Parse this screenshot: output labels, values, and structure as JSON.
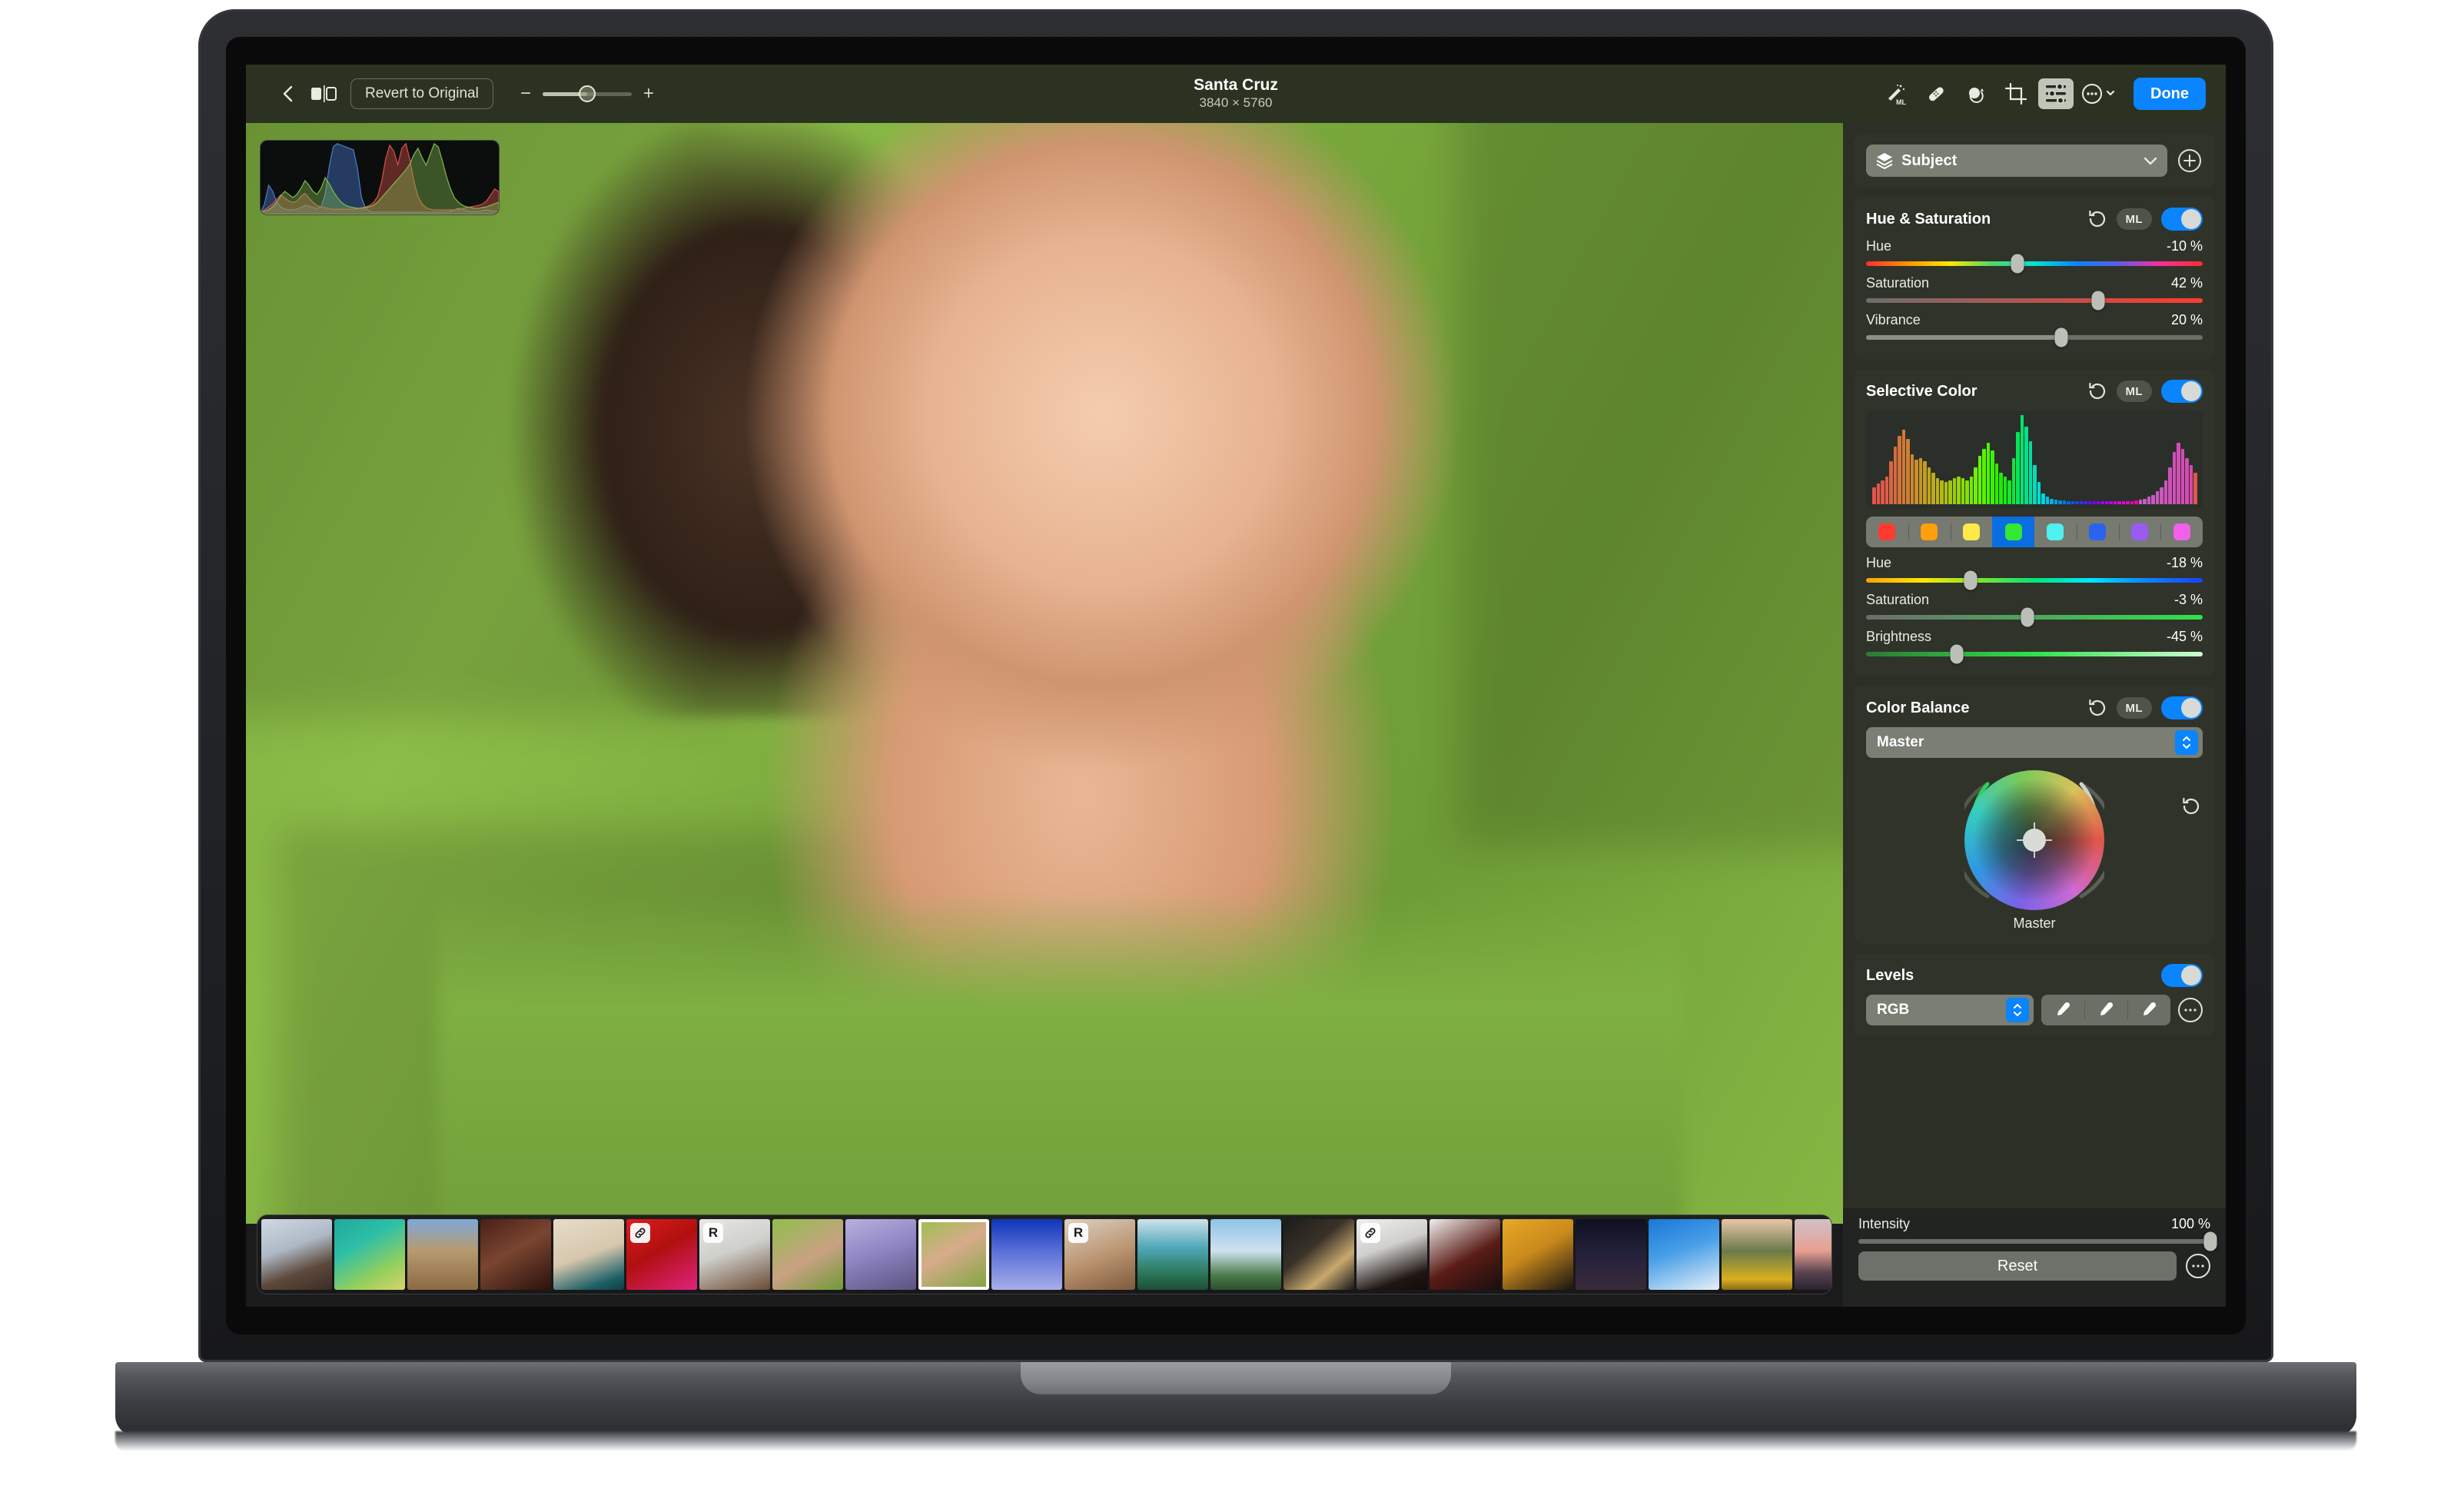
{
  "device": {
    "name": "macbook-pro",
    "camera": "camera-dot"
  },
  "toolbar": {
    "back_icon": "chevron-left-icon",
    "compare_icon": "before-after-split-icon",
    "revert_label": "Revert to Original",
    "zoom_minus": "−",
    "zoom_plus": "+",
    "zoom_value_pct": 50,
    "title": "Santa Cruz",
    "dimensions": "3840 × 5760",
    "tools": [
      {
        "name": "auto-enhance-ml-icon",
        "label": "ML",
        "active": false
      },
      {
        "name": "retouch-icon",
        "label": "",
        "active": false
      },
      {
        "name": "red-eye-icon",
        "label": "",
        "active": false
      },
      {
        "name": "crop-icon",
        "label": "",
        "active": false
      },
      {
        "name": "adjust-icon",
        "label": "",
        "active": true
      },
      {
        "name": "more-options-icon",
        "label": "",
        "active": false
      }
    ],
    "done_label": "Done"
  },
  "histogram_overlay": {
    "name": "rgb-histogram",
    "channels": [
      {
        "name": "blue",
        "color": "#4a7fd4",
        "points": [
          2,
          14,
          38,
          30,
          16,
          10,
          7,
          6,
          6,
          7,
          9,
          12,
          11,
          9,
          8,
          10,
          26,
          62,
          88,
          92,
          90,
          88,
          86,
          84,
          60,
          22,
          8,
          4,
          3,
          3,
          3,
          3,
          3,
          3,
          3,
          3,
          3,
          3,
          3,
          3,
          3,
          3,
          3,
          3,
          3,
          3,
          3,
          4,
          6,
          8,
          7,
          5,
          4,
          4,
          4,
          5,
          6,
          5,
          4,
          4
        ]
      },
      {
        "name": "red",
        "color": "#d9524a",
        "points": [
          3,
          6,
          10,
          14,
          20,
          26,
          22,
          18,
          16,
          18,
          24,
          28,
          22,
          16,
          12,
          10,
          9,
          8,
          7,
          7,
          7,
          7,
          7,
          7,
          8,
          9,
          10,
          12,
          16,
          24,
          44,
          74,
          92,
          84,
          66,
          88,
          94,
          72,
          44,
          24,
          14,
          9,
          7,
          6,
          6,
          6,
          6,
          6,
          6,
          7,
          8,
          9,
          10,
          11,
          12,
          14,
          18,
          26,
          34,
          30
        ]
      },
      {
        "name": "green",
        "color": "#7fbb4e",
        "points": [
          2,
          4,
          6,
          10,
          16,
          24,
          30,
          26,
          22,
          26,
          34,
          44,
          38,
          30,
          26,
          34,
          48,
          40,
          30,
          22,
          16,
          12,
          10,
          9,
          8,
          8,
          9,
          10,
          12,
          16,
          22,
          28,
          34,
          40,
          46,
          52,
          58,
          66,
          78,
          86,
          74,
          64,
          78,
          92,
          88,
          70,
          50,
          34,
          22,
          16,
          12,
          10,
          9,
          8,
          8,
          9,
          10,
          12,
          14,
          16
        ]
      }
    ]
  },
  "filmstrip": {
    "name": "photo-filmstrip",
    "selected_index": 9,
    "thumbnails": [
      {
        "name": "portrait-woman-profile",
        "badge": "",
        "css": "linear-gradient(160deg,#cfd9e2 0%,#aeb9c6 40%,#5d4a3c 70%,#3b2c22 100%)"
      },
      {
        "name": "underwater-coral",
        "badge": "",
        "css": "linear-gradient(150deg,#1fa89a 0%,#2dbfa8 35%,#8fcf5e 70%,#d9d36a 100%)"
      },
      {
        "name": "desert-arch",
        "badge": "",
        "css": "linear-gradient(180deg,#7fa8d8 0%,#b79a6e 45%,#8b6a44 100%)"
      },
      {
        "name": "portrait-dark-skin",
        "badge": "",
        "css": "linear-gradient(150deg,#4a2018 0%,#7a4530 45%,#2a120c 100%)"
      },
      {
        "name": "portrait-shadow-beige",
        "badge": "",
        "css": "linear-gradient(160deg,#e8ddc9 0%,#d6c7ad 50%,#1d5f66 85%,#123c44 100%)"
      },
      {
        "name": "portrait-red-background",
        "badge": "link-icon",
        "css": "linear-gradient(150deg,#e01b1b 0%,#b01010 45%,#e0227c 100%)"
      },
      {
        "name": "portrait-white-suit",
        "badge": "R",
        "css": "linear-gradient(160deg,#e7e7e5 0%,#cfcfcb 45%,#6a4a32 100%)"
      },
      {
        "name": "portrait-green-hood",
        "badge": "",
        "css": "linear-gradient(150deg,#8fbf4a 0%,#c9a184 55%,#6f9a36 100%)"
      },
      {
        "name": "portrait-lavender",
        "badge": "",
        "css": "linear-gradient(160deg,#b9b0de 0%,#8f86c4 45%,#5c5280 100%)"
      },
      {
        "name": "portrait-santa-cruz-selected",
        "badge": "",
        "css": "linear-gradient(150deg,#9bc04f 0%,#d7ab8b 45%,#7aa63c 100%)"
      },
      {
        "name": "blue-rocks",
        "badge": "",
        "css": "linear-gradient(180deg,#1034b8 0%,#5a6fd8 45%,#a8aee8 100%)"
      },
      {
        "name": "portrait-braids-beige",
        "badge": "R",
        "css": "linear-gradient(160deg,#ddd2c2 0%,#b9926e 55%,#7d5a3c 100%)"
      },
      {
        "name": "aerial-beach",
        "badge": "",
        "css": "linear-gradient(180deg,#cfe2ea 0%,#4fa8b8 40%,#2e7a5c 75%,#1c4e38 100%)"
      },
      {
        "name": "clouds-mountain",
        "badge": "",
        "css": "linear-gradient(180deg,#8fc3e8 0%,#cfe2f0 45%,#4a7a4a 80%,#2c4e2e 100%)"
      },
      {
        "name": "modern-building",
        "badge": "",
        "css": "linear-gradient(140deg,#1b1b1d 0%,#3a3228 40%,#c8a86e 70%,#17171a 100%)"
      },
      {
        "name": "silhouette-portrait-white",
        "badge": "link-icon",
        "css": "linear-gradient(160deg,#efefee 0%,#cfcfcd 40%,#201613 80%,#120c0a 100%)"
      },
      {
        "name": "silhouette-portrait-dark",
        "badge": "",
        "css": "linear-gradient(150deg,#efefee 0%,#5b1c16 55%,#170e0c 100%)"
      },
      {
        "name": "silhouette-orange",
        "badge": "",
        "css": "linear-gradient(150deg,#e8a828 0%,#c98a1c 45%,#1a1410 100%)"
      },
      {
        "name": "night-flowers",
        "badge": "",
        "css": "linear-gradient(180deg,#0d1020 0%,#23203a 45%,#3a2a3a 100%)"
      },
      {
        "name": "snowboarder",
        "badge": "",
        "css": "linear-gradient(160deg,#1878d8 0%,#4aa0e8 45%,#e8f0f8 100%)"
      },
      {
        "name": "golden-mountain",
        "badge": "",
        "css": "linear-gradient(180deg,#e8c6a8 0%,#6a7a4a 45%,#d8b020 85%,#8a6a18 100%)"
      },
      {
        "name": "pink-sunset-peak",
        "badge": "",
        "css": "linear-gradient(180deg,#cfc0c8 0%,#e8a090 45%,#5a4450 75%,#2a2230 100%)"
      },
      {
        "name": "architecture-white-stairs",
        "badge": "link-icon",
        "css": "linear-gradient(150deg,#e6e6e6 0%,#c4c4c4 50%,#9a9a9a 100%)"
      },
      {
        "name": "blue-building-facade",
        "badge": "",
        "css": "linear-gradient(160deg,#10447a 0%,#1a5a9a 50%,#0c2c52 100%)"
      }
    ]
  },
  "inspector": {
    "selection": {
      "name": "subject-selection",
      "icon": "layers-icon",
      "label": "Subject",
      "chevron_icon": "chevron-down-icon",
      "add_icon": "add-circle-icon"
    },
    "hue_saturation": {
      "title": "Hue & Saturation",
      "revert_icon": "revert-arrow-icon",
      "ml_label": "ML",
      "enabled": true,
      "sliders": [
        {
          "name": "hue",
          "label": "Hue",
          "value": "-10 %",
          "pos_pct": 45,
          "kind": "hue-full"
        },
        {
          "name": "saturation",
          "label": "Saturation",
          "value": "42 %",
          "pos_pct": 69,
          "kind": "sat-red"
        },
        {
          "name": "vibrance",
          "label": "Vibrance",
          "value": "20 %",
          "pos_pct": 58,
          "kind": "plain"
        }
      ]
    },
    "selective_color": {
      "title": "Selective Color",
      "revert_icon": "revert-arrow-icon",
      "ml_label": "ML",
      "enabled": true,
      "selected_swatch_index": 3,
      "swatches": [
        {
          "name": "swatch-red",
          "color": "#ff3b30"
        },
        {
          "name": "swatch-orange",
          "color": "#ff9f0a"
        },
        {
          "name": "swatch-yellow",
          "color": "#ffe94a"
        },
        {
          "name": "swatch-green",
          "color": "#34e834"
        },
        {
          "name": "swatch-cyan",
          "color": "#4ff0f0"
        },
        {
          "name": "swatch-blue",
          "color": "#2b62f0"
        },
        {
          "name": "swatch-purple",
          "color": "#9a5cf0"
        },
        {
          "name": "swatch-magenta",
          "color": "#f060e8"
        }
      ],
      "sliders": [
        {
          "name": "hue",
          "label": "Hue",
          "value": "-18 %",
          "pos_pct": 31,
          "kind": "hue-sel"
        },
        {
          "name": "saturation",
          "label": "Saturation",
          "value": "-3 %",
          "pos_pct": 48,
          "kind": "sat-green"
        },
        {
          "name": "brightness",
          "label": "Brightness",
          "value": "-45 %",
          "pos_pct": 27,
          "kind": "bri-green"
        }
      ]
    },
    "hue_histogram": {
      "name": "hue-histogram",
      "values": [
        18,
        22,
        26,
        30,
        46,
        62,
        74,
        80,
        70,
        54,
        48,
        50,
        46,
        40,
        34,
        28,
        26,
        24,
        26,
        28,
        30,
        28,
        26,
        30,
        40,
        52,
        60,
        66,
        58,
        44,
        34,
        30,
        26,
        50,
        78,
        96,
        84,
        68,
        42,
        24,
        12,
        8,
        6,
        5,
        4,
        4,
        3,
        3,
        3,
        3,
        3,
        3,
        3,
        3,
        3,
        3,
        3,
        3,
        3,
        3,
        3,
        3,
        4,
        5,
        6,
        8,
        10,
        14,
        18,
        26,
        40,
        56,
        66,
        60,
        50,
        42,
        34
      ],
      "colors": [
        "#e2564a",
        "#e2564a",
        "#e2564a",
        "#de5d46",
        "#db6442",
        "#d86b3e",
        "#d5723a",
        "#d27936",
        "#cf8032",
        "#cc872e",
        "#c98e2a",
        "#c69526",
        "#c39c22",
        "#c0a31e",
        "#bdaa1a",
        "#baB116",
        "#b7b812",
        "#aebf10",
        "#a5c60e",
        "#9ccd0c",
        "#93d40a",
        "#8adb08",
        "#81e206",
        "#78e904",
        "#6ff002",
        "#66f700",
        "#58f500",
        "#4af300",
        "#3cf100",
        "#2eef00",
        "#20ed00",
        "#18eb10",
        "#12e928",
        "#0ce740",
        "#06e558",
        "#00e370",
        "#00e188",
        "#00dfa0",
        "#00ddb8",
        "#00dbd0",
        "#00d4de",
        "#00c2e0",
        "#00b0e2",
        "#009ee4",
        "#008ce6",
        "#007ae8",
        "#0068ea",
        "#0a56ec",
        "#2044ee",
        "#3632f0",
        "#4c20f2",
        "#620ef4",
        "#7800f6",
        "#8a00f4",
        "#9c00f2",
        "#ae00f0",
        "#c000ee",
        "#d200ec",
        "#e400ea",
        "#ec00dc",
        "#ee00c6",
        "#f000b0",
        "#f2009a",
        "#c060c8",
        "#c25ec6",
        "#c45cc4",
        "#c65ac2",
        "#c858c0",
        "#ca56be",
        "#cc54bc",
        "#ce52ba",
        "#d050b8",
        "#d24eb6",
        "#d44cb4",
        "#d64ab2",
        "#d848b0"
      ]
    },
    "color_balance": {
      "title": "Color Balance",
      "revert_icon": "revert-arrow-icon",
      "ml_label": "ML",
      "enabled": true,
      "mode_label": "Master",
      "stepper_icon": "stepper-up-down-icon",
      "wheel_label": "Master",
      "wheel_reset_icon": "revert-arrow-icon",
      "left_arc": {
        "name": "luminance-arc",
        "color": "#2fd05a",
        "knob_pct": 48
      },
      "right_arc": {
        "name": "temperature-arc",
        "color": "#d0d3cc",
        "knob_pct": 45
      }
    },
    "levels": {
      "title": "Levels",
      "enabled": true,
      "channel_label": "RGB",
      "stepper_icon": "stepper-up-down-icon",
      "eyedroppers": [
        {
          "name": "black-point-eyedropper-icon"
        },
        {
          "name": "gray-point-eyedropper-icon"
        },
        {
          "name": "white-point-eyedropper-icon"
        }
      ],
      "more_icon": "more-options-icon"
    },
    "intensity": {
      "name": "intensity-slider",
      "label": "Intensity",
      "value": "100 %",
      "pos_pct": 100
    },
    "reset": {
      "label": "Reset",
      "more_icon": "more-options-icon"
    }
  },
  "colors": {
    "accent_blue": "#0a84ff",
    "panel_bg": "#2b2f26",
    "card_bg": "#2f332a",
    "toolbar_bg": "#2c3422"
  }
}
